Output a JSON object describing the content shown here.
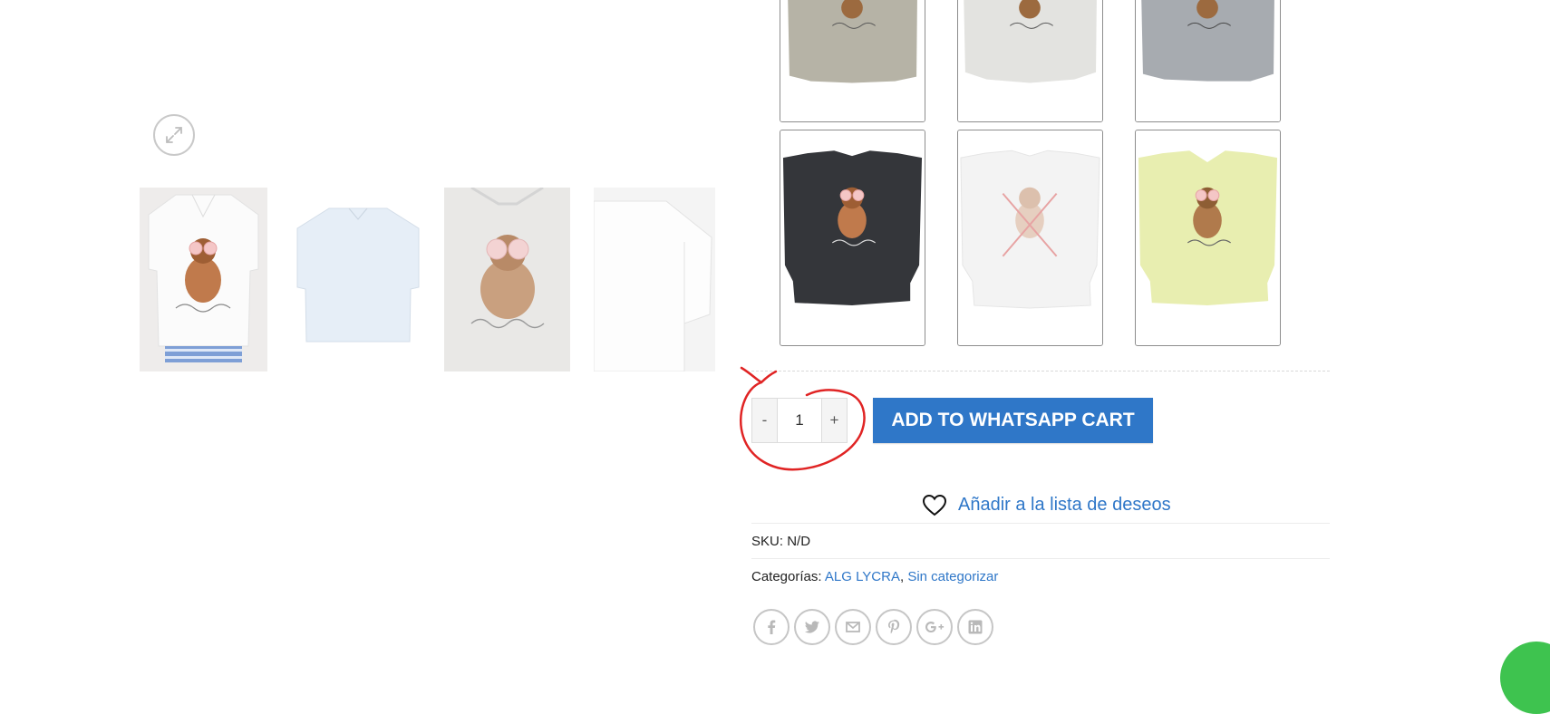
{
  "gallery": {
    "zoom_label": "",
    "thumbnails": [
      "t-shirt-front-model",
      "t-shirt-white-flat",
      "t-shirt-print-closeup",
      "t-shirt-sleeve-detail"
    ]
  },
  "variations": {
    "swatches": [
      {
        "name": "olive",
        "color": "#b6b3a6"
      },
      {
        "name": "light-grey",
        "color": "#e3e3e0"
      },
      {
        "name": "blue-grey",
        "color": "#a7abb0"
      },
      {
        "name": "black",
        "color": "#34363a"
      },
      {
        "name": "white-unavailable",
        "color": "#f3f3f3"
      },
      {
        "name": "lime",
        "color": "#e8eeb0"
      }
    ]
  },
  "cart": {
    "minus": "-",
    "quantity": "1",
    "plus": "+",
    "add_button": "ADD TO WHATSAPP CART"
  },
  "wishlist": {
    "label": "Añadir a la lista de deseos"
  },
  "meta": {
    "sku_label": "SKU:",
    "sku_value": "N/D",
    "categories_label": "Categorías:",
    "category_1": "ALG LYCRA",
    "comma": ",",
    "category_2": "Sin categorizar"
  },
  "share": {
    "icons": [
      "facebook-icon",
      "twitter-icon",
      "email-icon",
      "pinterest-icon",
      "google-plus-icon",
      "linkedin-icon"
    ]
  },
  "colors": {
    "accent": "#2f77c8",
    "annotation": "#e02424",
    "whatsapp": "#3ec34f"
  }
}
